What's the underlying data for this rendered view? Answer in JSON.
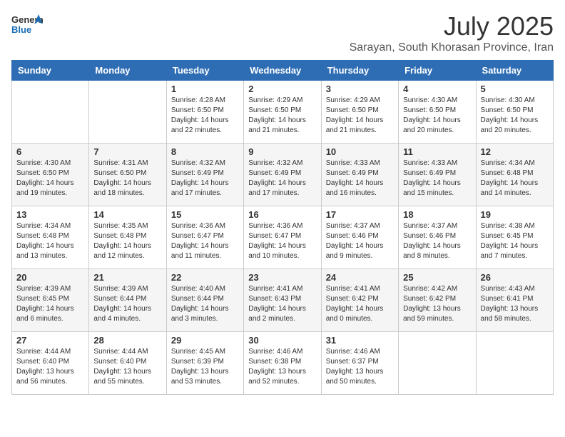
{
  "header": {
    "logo_general": "General",
    "logo_blue": "Blue",
    "month_year": "July 2025",
    "location": "Sarayan, South Khorasan Province, Iran"
  },
  "weekdays": [
    "Sunday",
    "Monday",
    "Tuesday",
    "Wednesday",
    "Thursday",
    "Friday",
    "Saturday"
  ],
  "weeks": [
    [
      {
        "day": "",
        "detail": ""
      },
      {
        "day": "",
        "detail": ""
      },
      {
        "day": "1",
        "detail": "Sunrise: 4:28 AM\nSunset: 6:50 PM\nDaylight: 14 hours\nand 22 minutes."
      },
      {
        "day": "2",
        "detail": "Sunrise: 4:29 AM\nSunset: 6:50 PM\nDaylight: 14 hours\nand 21 minutes."
      },
      {
        "day": "3",
        "detail": "Sunrise: 4:29 AM\nSunset: 6:50 PM\nDaylight: 14 hours\nand 21 minutes."
      },
      {
        "day": "4",
        "detail": "Sunrise: 4:30 AM\nSunset: 6:50 PM\nDaylight: 14 hours\nand 20 minutes."
      },
      {
        "day": "5",
        "detail": "Sunrise: 4:30 AM\nSunset: 6:50 PM\nDaylight: 14 hours\nand 20 minutes."
      }
    ],
    [
      {
        "day": "6",
        "detail": "Sunrise: 4:30 AM\nSunset: 6:50 PM\nDaylight: 14 hours\nand 19 minutes."
      },
      {
        "day": "7",
        "detail": "Sunrise: 4:31 AM\nSunset: 6:50 PM\nDaylight: 14 hours\nand 18 minutes."
      },
      {
        "day": "8",
        "detail": "Sunrise: 4:32 AM\nSunset: 6:49 PM\nDaylight: 14 hours\nand 17 minutes."
      },
      {
        "day": "9",
        "detail": "Sunrise: 4:32 AM\nSunset: 6:49 PM\nDaylight: 14 hours\nand 17 minutes."
      },
      {
        "day": "10",
        "detail": "Sunrise: 4:33 AM\nSunset: 6:49 PM\nDaylight: 14 hours\nand 16 minutes."
      },
      {
        "day": "11",
        "detail": "Sunrise: 4:33 AM\nSunset: 6:49 PM\nDaylight: 14 hours\nand 15 minutes."
      },
      {
        "day": "12",
        "detail": "Sunrise: 4:34 AM\nSunset: 6:48 PM\nDaylight: 14 hours\nand 14 minutes."
      }
    ],
    [
      {
        "day": "13",
        "detail": "Sunrise: 4:34 AM\nSunset: 6:48 PM\nDaylight: 14 hours\nand 13 minutes."
      },
      {
        "day": "14",
        "detail": "Sunrise: 4:35 AM\nSunset: 6:48 PM\nDaylight: 14 hours\nand 12 minutes."
      },
      {
        "day": "15",
        "detail": "Sunrise: 4:36 AM\nSunset: 6:47 PM\nDaylight: 14 hours\nand 11 minutes."
      },
      {
        "day": "16",
        "detail": "Sunrise: 4:36 AM\nSunset: 6:47 PM\nDaylight: 14 hours\nand 10 minutes."
      },
      {
        "day": "17",
        "detail": "Sunrise: 4:37 AM\nSunset: 6:46 PM\nDaylight: 14 hours\nand 9 minutes."
      },
      {
        "day": "18",
        "detail": "Sunrise: 4:37 AM\nSunset: 6:46 PM\nDaylight: 14 hours\nand 8 minutes."
      },
      {
        "day": "19",
        "detail": "Sunrise: 4:38 AM\nSunset: 6:45 PM\nDaylight: 14 hours\nand 7 minutes."
      }
    ],
    [
      {
        "day": "20",
        "detail": "Sunrise: 4:39 AM\nSunset: 6:45 PM\nDaylight: 14 hours\nand 6 minutes."
      },
      {
        "day": "21",
        "detail": "Sunrise: 4:39 AM\nSunset: 6:44 PM\nDaylight: 14 hours\nand 4 minutes."
      },
      {
        "day": "22",
        "detail": "Sunrise: 4:40 AM\nSunset: 6:44 PM\nDaylight: 14 hours\nand 3 minutes."
      },
      {
        "day": "23",
        "detail": "Sunrise: 4:41 AM\nSunset: 6:43 PM\nDaylight: 14 hours\nand 2 minutes."
      },
      {
        "day": "24",
        "detail": "Sunrise: 4:41 AM\nSunset: 6:42 PM\nDaylight: 14 hours\nand 0 minutes."
      },
      {
        "day": "25",
        "detail": "Sunrise: 4:42 AM\nSunset: 6:42 PM\nDaylight: 13 hours\nand 59 minutes."
      },
      {
        "day": "26",
        "detail": "Sunrise: 4:43 AM\nSunset: 6:41 PM\nDaylight: 13 hours\nand 58 minutes."
      }
    ],
    [
      {
        "day": "27",
        "detail": "Sunrise: 4:44 AM\nSunset: 6:40 PM\nDaylight: 13 hours\nand 56 minutes."
      },
      {
        "day": "28",
        "detail": "Sunrise: 4:44 AM\nSunset: 6:40 PM\nDaylight: 13 hours\nand 55 minutes."
      },
      {
        "day": "29",
        "detail": "Sunrise: 4:45 AM\nSunset: 6:39 PM\nDaylight: 13 hours\nand 53 minutes."
      },
      {
        "day": "30",
        "detail": "Sunrise: 4:46 AM\nSunset: 6:38 PM\nDaylight: 13 hours\nand 52 minutes."
      },
      {
        "day": "31",
        "detail": "Sunrise: 4:46 AM\nSunset: 6:37 PM\nDaylight: 13 hours\nand 50 minutes."
      },
      {
        "day": "",
        "detail": ""
      },
      {
        "day": "",
        "detail": ""
      }
    ]
  ]
}
